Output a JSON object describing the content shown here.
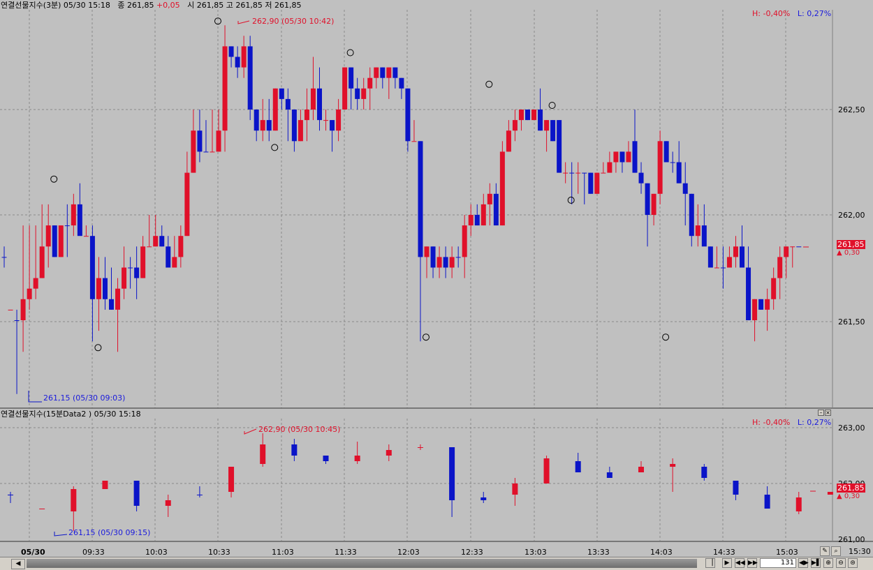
{
  "colors": {
    "up": "#e0102a",
    "down": "#0a14c8",
    "grid": "#8a8a8a",
    "background": "#c0c0c0"
  },
  "pane1": {
    "header": {
      "title": "연결선물지수(3분)",
      "datetime": "05/30 15:18",
      "close_label": "종",
      "close": "261,85",
      "change": "+0,05",
      "ohl": "시 261,85 고 261,85 저 261,85"
    },
    "hl_high": "H: -0,40%",
    "hl_low": "L: 0,27%",
    "high_marker": "262,90 (05/30 10:42)",
    "low_marker": "261,15 (05/30 09:03)",
    "last_price": "261,85",
    "last_change": "▲ 0,30"
  },
  "pane2": {
    "header": "연결선물지수(15분Data2 ) 05/30 15:18",
    "hl_high": "H: -0,40%",
    "hl_low": "L: 0,27%",
    "high_marker": "262,90 (05/30 10:45)",
    "low_marker": "261,15 (05/30 09:15)",
    "last_price": "261,85",
    "last_change": "▲ 0,30"
  },
  "toolbar": {
    "count": "131",
    "end_time": "15:30"
  },
  "chart_data": [
    {
      "type": "candlestick",
      "title": "연결선물지수(3분)",
      "y_ticks": [
        "262,50",
        "262,00",
        "261,50"
      ],
      "ylim": [
        261.1,
        262.95
      ],
      "bars": [
        [
          261.8,
          261.85,
          261.75,
          261.8
        ],
        [
          261.55,
          261.55,
          261.55,
          261.55
        ],
        [
          261.5,
          261.55,
          261.15,
          261.5
        ],
        [
          261.5,
          261.95,
          261.35,
          261.6
        ],
        [
          261.6,
          261.95,
          261.55,
          261.65
        ],
        [
          261.65,
          261.95,
          261.6,
          261.7
        ],
        [
          261.7,
          262.05,
          261.7,
          261.85
        ],
        [
          261.85,
          262.05,
          261.75,
          261.95
        ],
        [
          261.95,
          261.95,
          261.8,
          261.8
        ],
        [
          261.8,
          261.95,
          261.8,
          261.95
        ],
        [
          261.95,
          262.05,
          261.8,
          261.95
        ],
        [
          261.95,
          262.1,
          261.9,
          262.05
        ],
        [
          262.05,
          262.15,
          261.95,
          261.9
        ],
        [
          261.9,
          261.95,
          261.9,
          261.9
        ],
        [
          261.9,
          261.95,
          261.4,
          261.6
        ],
        [
          261.6,
          261.8,
          261.45,
          261.7
        ],
        [
          261.7,
          261.8,
          261.55,
          261.6
        ],
        [
          261.6,
          261.75,
          261.55,
          261.55
        ],
        [
          261.55,
          261.7,
          261.35,
          261.65
        ],
        [
          261.65,
          261.85,
          261.6,
          261.75
        ],
        [
          261.75,
          261.8,
          261.65,
          261.75
        ],
        [
          261.75,
          261.85,
          261.6,
          261.7
        ],
        [
          261.7,
          261.9,
          261.7,
          261.85
        ],
        [
          261.85,
          262.0,
          261.85,
          261.85
        ],
        [
          261.85,
          262.0,
          261.85,
          261.9
        ],
        [
          261.9,
          261.95,
          261.85,
          261.85
        ],
        [
          261.85,
          261.9,
          261.8,
          261.75
        ],
        [
          261.75,
          261.9,
          261.75,
          261.8
        ],
        [
          261.8,
          261.95,
          261.75,
          261.9
        ],
        [
          261.9,
          262.3,
          261.9,
          262.2
        ],
        [
          262.2,
          262.5,
          262.2,
          262.4
        ],
        [
          262.4,
          262.5,
          262.25,
          262.3
        ],
        [
          262.3,
          262.45,
          262.3,
          262.3
        ],
        [
          262.3,
          262.5,
          262.3,
          262.3
        ],
        [
          262.3,
          262.5,
          262.3,
          262.4
        ],
        [
          262.4,
          262.9,
          262.3,
          262.8
        ],
        [
          262.8,
          262.8,
          262.7,
          262.75
        ],
        [
          262.75,
          262.8,
          262.65,
          262.7
        ],
        [
          262.7,
          262.85,
          262.65,
          262.8
        ],
        [
          262.8,
          262.85,
          262.45,
          262.5
        ],
        [
          262.5,
          262.5,
          262.35,
          262.4
        ],
        [
          262.4,
          262.55,
          262.35,
          262.45
        ],
        [
          262.45,
          262.55,
          262.35,
          262.4
        ],
        [
          262.4,
          262.6,
          262.4,
          262.6
        ],
        [
          262.6,
          262.6,
          262.5,
          262.55
        ],
        [
          262.55,
          262.6,
          262.35,
          262.5
        ],
        [
          262.5,
          262.5,
          262.3,
          262.35
        ],
        [
          262.35,
          262.5,
          262.35,
          262.45
        ],
        [
          262.45,
          262.6,
          262.35,
          262.5
        ],
        [
          262.5,
          262.75,
          262.45,
          262.6
        ],
        [
          262.6,
          262.7,
          262.4,
          262.45
        ],
        [
          262.45,
          262.5,
          262.4,
          262.45
        ],
        [
          262.45,
          262.45,
          262.3,
          262.4
        ],
        [
          262.4,
          262.55,
          262.35,
          262.5
        ],
        [
          262.5,
          262.7,
          262.5,
          262.7
        ],
        [
          262.7,
          262.7,
          262.5,
          262.6
        ],
        [
          262.6,
          262.65,
          262.5,
          262.55
        ],
        [
          262.55,
          262.65,
          262.5,
          262.6
        ],
        [
          262.6,
          262.7,
          262.5,
          262.65
        ],
        [
          262.65,
          262.7,
          262.6,
          262.7
        ],
        [
          262.7,
          262.7,
          262.6,
          262.65
        ],
        [
          262.65,
          262.7,
          262.55,
          262.7
        ],
        [
          262.7,
          262.7,
          262.6,
          262.65
        ],
        [
          262.65,
          262.65,
          262.55,
          262.6
        ],
        [
          262.6,
          262.6,
          262.3,
          262.35
        ],
        [
          262.35,
          262.45,
          262.35,
          262.35
        ],
        [
          262.35,
          262.35,
          261.4,
          261.8
        ],
        [
          261.8,
          261.85,
          261.7,
          261.85
        ],
        [
          261.85,
          261.85,
          261.7,
          261.75
        ],
        [
          261.75,
          261.85,
          261.7,
          261.8
        ],
        [
          261.8,
          261.85,
          261.7,
          261.75
        ],
        [
          261.75,
          261.85,
          261.7,
          261.8
        ],
        [
          261.8,
          261.85,
          261.75,
          261.8
        ],
        [
          261.8,
          262.0,
          261.7,
          261.95
        ],
        [
          261.95,
          262.05,
          261.9,
          262.0
        ],
        [
          262.0,
          262.05,
          261.95,
          261.95
        ],
        [
          261.95,
          262.1,
          261.95,
          262.05
        ],
        [
          262.05,
          262.15,
          261.95,
          262.1
        ],
        [
          262.1,
          262.15,
          261.95,
          261.95
        ],
        [
          261.95,
          262.35,
          261.95,
          262.3
        ],
        [
          262.3,
          262.45,
          262.3,
          262.4
        ],
        [
          262.4,
          262.5,
          262.35,
          262.45
        ],
        [
          262.45,
          262.5,
          262.4,
          262.5
        ],
        [
          262.5,
          262.5,
          262.45,
          262.45
        ],
        [
          262.45,
          262.5,
          262.45,
          262.5
        ],
        [
          262.5,
          262.6,
          262.4,
          262.4
        ],
        [
          262.4,
          262.45,
          262.3,
          262.45
        ],
        [
          262.45,
          262.45,
          262.35,
          262.35
        ],
        [
          262.45,
          262.45,
          262.2,
          262.2
        ],
        [
          262.2,
          262.25,
          262.15,
          262.2
        ],
        [
          262.2,
          262.25,
          262.05,
          262.2
        ],
        [
          262.2,
          262.25,
          262.1,
          262.2
        ],
        [
          262.2,
          262.2,
          262.05,
          262.2
        ],
        [
          262.2,
          262.2,
          262.1,
          262.1
        ],
        [
          262.1,
          262.2,
          262.1,
          262.2
        ],
        [
          262.2,
          262.25,
          262.2,
          262.2
        ],
        [
          262.2,
          262.3,
          262.2,
          262.25
        ],
        [
          262.25,
          262.3,
          262.2,
          262.3
        ],
        [
          262.3,
          262.3,
          262.2,
          262.25
        ],
        [
          262.25,
          262.35,
          262.25,
          262.3
        ],
        [
          262.35,
          262.5,
          262.2,
          262.2
        ],
        [
          262.2,
          262.25,
          262.1,
          262.15
        ],
        [
          262.15,
          262.15,
          261.85,
          262.0
        ],
        [
          262.0,
          262.1,
          261.95,
          262.1
        ],
        [
          262.1,
          262.4,
          262.05,
          262.35
        ],
        [
          262.35,
          262.35,
          262.25,
          262.25
        ],
        [
          262.25,
          262.3,
          262.2,
          262.25
        ],
        [
          262.25,
          262.35,
          262.15,
          262.15
        ],
        [
          262.15,
          262.25,
          261.95,
          262.1
        ],
        [
          262.1,
          262.1,
          261.85,
          261.9
        ],
        [
          261.9,
          262.05,
          261.85,
          261.95
        ],
        [
          261.95,
          262.05,
          261.9,
          261.85
        ],
        [
          261.85,
          261.85,
          261.8,
          261.75
        ],
        [
          261.75,
          261.85,
          261.75,
          261.75
        ],
        [
          261.75,
          261.85,
          261.65,
          261.75
        ],
        [
          261.75,
          261.85,
          261.75,
          261.8
        ],
        [
          261.8,
          261.9,
          261.75,
          261.85
        ],
        [
          261.85,
          261.95,
          261.75,
          261.75
        ],
        [
          261.75,
          261.85,
          261.5,
          261.5
        ],
        [
          261.5,
          261.6,
          261.4,
          261.6
        ],
        [
          261.6,
          261.6,
          261.55,
          261.55
        ],
        [
          261.55,
          261.65,
          261.45,
          261.6
        ],
        [
          261.6,
          261.75,
          261.55,
          261.7
        ],
        [
          261.7,
          261.85,
          261.6,
          261.8
        ],
        [
          261.8,
          261.85,
          261.7,
          261.85
        ],
        [
          261.85,
          261.85,
          261.75,
          261.85
        ],
        [
          261.85,
          261.85,
          261.85,
          261.85
        ]
      ],
      "circles": [
        [
          7,
          262.15
        ],
        [
          14,
          261.35
        ],
        [
          33,
          262.9
        ],
        [
          42,
          262.3
        ],
        [
          54,
          262.75
        ],
        [
          66,
          261.4
        ],
        [
          76,
          262.6
        ],
        [
          86,
          262.5
        ],
        [
          89,
          262.05
        ],
        [
          104,
          261.4
        ]
      ]
    },
    {
      "type": "candlestick",
      "title": "연결선물지수(15분Data2 )",
      "y_ticks": [
        "263,00",
        "262,00",
        "261,00"
      ],
      "ylim": [
        261.0,
        263.0
      ],
      "bars": [
        [
          261.8,
          261.85,
          261.65,
          261.8
        ],
        [
          261.55,
          261.55,
          261.55,
          261.55
        ],
        [
          261.5,
          261.95,
          261.15,
          261.9
        ],
        [
          261.9,
          262.05,
          261.9,
          262.05
        ],
        [
          262.05,
          262.05,
          261.5,
          261.6
        ],
        [
          261.6,
          261.8,
          261.4,
          261.7
        ],
        [
          261.8,
          261.95,
          261.75,
          261.8
        ],
        [
          261.85,
          262.3,
          261.75,
          262.3
        ],
        [
          262.35,
          262.9,
          262.3,
          262.7
        ],
        [
          262.7,
          262.8,
          262.4,
          262.5
        ],
        [
          262.5,
          262.5,
          262.35,
          262.4
        ],
        [
          262.4,
          262.75,
          262.35,
          262.5
        ],
        [
          262.5,
          262.7,
          262.4,
          262.6
        ],
        [
          262.65,
          262.7,
          262.6,
          262.65
        ],
        [
          262.65,
          262.65,
          261.4,
          261.7
        ],
        [
          261.75,
          261.85,
          261.65,
          261.7
        ],
        [
          261.8,
          262.1,
          261.6,
          262.0
        ],
        [
          262.0,
          262.5,
          262.0,
          262.45
        ],
        [
          262.4,
          262.55,
          262.2,
          262.2
        ],
        [
          262.2,
          262.3,
          262.1,
          262.1
        ],
        [
          262.2,
          262.4,
          262.2,
          262.3
        ],
        [
          262.3,
          262.45,
          261.85,
          262.35
        ],
        [
          262.3,
          262.35,
          262.05,
          262.1
        ],
        [
          262.05,
          262.05,
          261.7,
          261.8
        ],
        [
          261.8,
          261.95,
          261.55,
          261.55
        ],
        [
          261.5,
          261.85,
          261.45,
          261.75
        ],
        [
          261.8,
          261.85,
          261.8,
          261.85
        ]
      ]
    }
  ]
}
